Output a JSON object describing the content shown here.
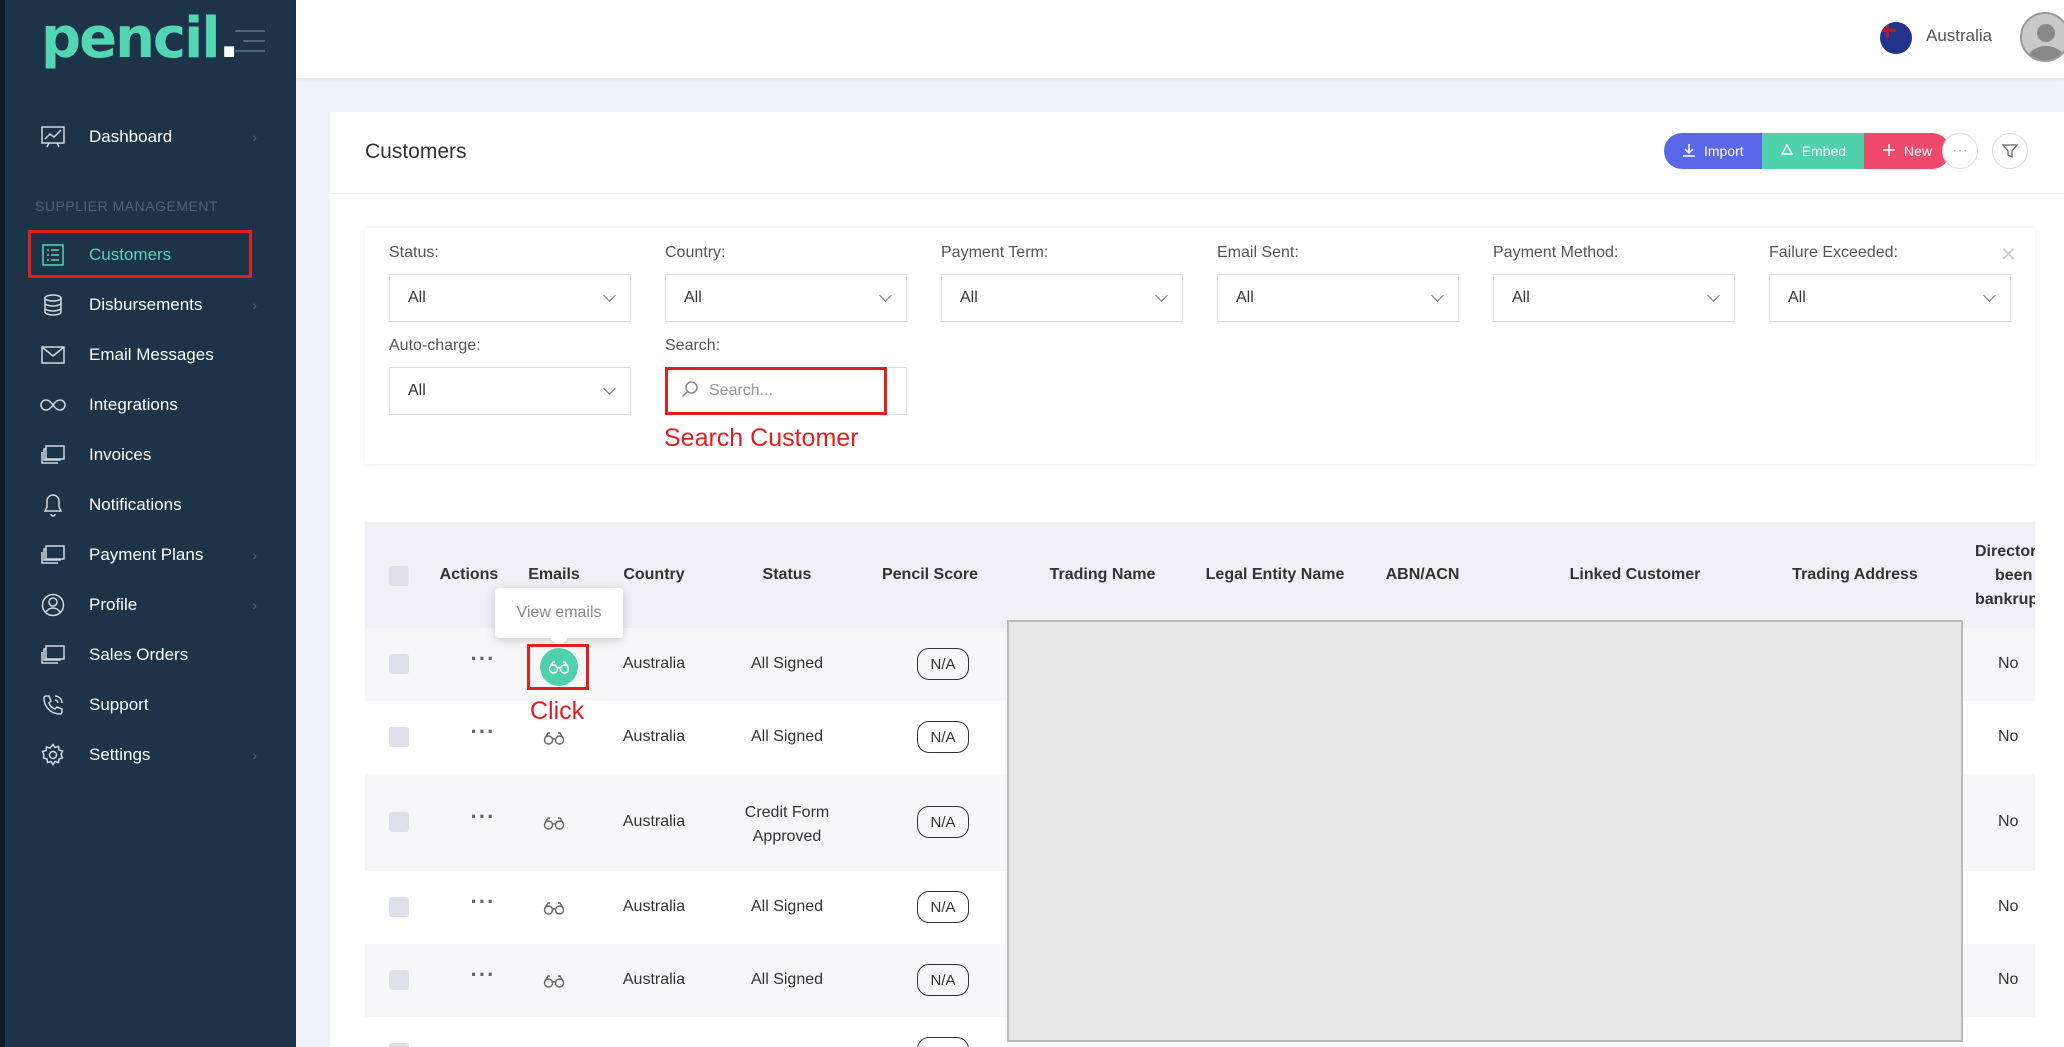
{
  "brand": {
    "name": "pencil",
    "dot": "."
  },
  "sidebar": {
    "section_label": "SUPPLIER MANAGEMENT",
    "items": [
      {
        "label": "Dashboard",
        "icon": "chart-icon",
        "chevron": true
      },
      {
        "label": "Customers",
        "icon": "list-icon",
        "active": true
      },
      {
        "label": "Disbursements",
        "icon": "coins-icon",
        "chevron": true
      },
      {
        "label": "Email Messages",
        "icon": "envelope-icon"
      },
      {
        "label": "Integrations",
        "icon": "infinity-icon"
      },
      {
        "label": "Invoices",
        "icon": "invoice-icon"
      },
      {
        "label": "Notifications",
        "icon": "bell-icon"
      },
      {
        "label": "Payment Plans",
        "icon": "payment-plans-icon",
        "chevron": true
      },
      {
        "label": "Profile",
        "icon": "profile-icon",
        "chevron": true
      },
      {
        "label": "Sales Orders",
        "icon": "sales-orders-icon"
      },
      {
        "label": "Support",
        "icon": "support-icon"
      },
      {
        "label": "Settings",
        "icon": "gear-icon",
        "chevron": true
      }
    ]
  },
  "topbar": {
    "country": "Australia"
  },
  "page": {
    "title": "Customers",
    "buttons": {
      "import": "Import",
      "embed": "Embed",
      "new": "New"
    }
  },
  "filters": {
    "status": {
      "label": "Status:",
      "value": "All"
    },
    "country": {
      "label": "Country:",
      "value": "All"
    },
    "payment_term": {
      "label": "Payment Term:",
      "value": "All"
    },
    "email_sent": {
      "label": "Email Sent:",
      "value": "All"
    },
    "payment_method": {
      "label": "Payment Method:",
      "value": "All"
    },
    "failure_exceeded": {
      "label": "Failure Exceeded:",
      "value": "All"
    },
    "auto_charge": {
      "label": "Auto-charge:",
      "value": "All"
    },
    "search": {
      "label": "Search:",
      "placeholder": "Search..."
    }
  },
  "annotations": {
    "search": "Search Customer",
    "click": "Click"
  },
  "tooltip": "View emails",
  "table": {
    "headers": {
      "actions": "Actions",
      "emails": "Emails",
      "country": "Country",
      "status": "Status",
      "pencil_score": "Pencil Score",
      "trading_name": "Trading Name",
      "legal_entity": "Legal Entity Name",
      "abn": "ABN/ACN",
      "linked": "Linked Customer",
      "address": "Trading Address",
      "director": [
        "Director",
        "been",
        "bankrup"
      ]
    },
    "rows": [
      {
        "country": "Australia",
        "status": "All Signed",
        "score": "N/A",
        "director": "No"
      },
      {
        "country": "Australia",
        "status": "All Signed",
        "score": "N/A",
        "director": "No"
      },
      {
        "country": "Australia",
        "status": [
          "Credit Form",
          "Approved"
        ],
        "score": "N/A",
        "director": "No"
      },
      {
        "country": "Australia",
        "status": "All Signed",
        "score": "N/A",
        "director": "No"
      },
      {
        "country": "Australia",
        "status": "All Signed",
        "score": "N/A",
        "director": "No"
      }
    ]
  },
  "colors": {
    "sidebar_bg": "#1d3448",
    "accent": "#52d6b4",
    "import": "#5a67e6",
    "embed": "#4fd1a9",
    "new": "#ef4a6b",
    "annotation": "#e02020"
  }
}
